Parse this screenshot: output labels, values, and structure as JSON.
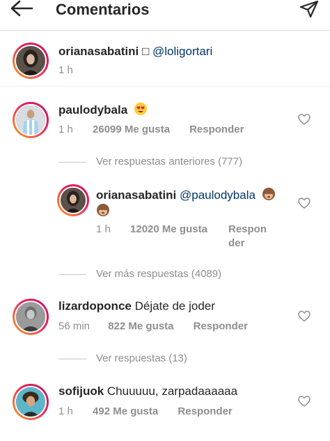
{
  "header": {
    "title": "Comentarios",
    "back_icon": "arrow-left-icon",
    "send_icon": "paper-plane-icon"
  },
  "caption": {
    "username": "orianasabatini",
    "glyph": "□",
    "mention": "@loligortari",
    "time": "1 h"
  },
  "comments": [
    {
      "username": "paulodybala",
      "text": "",
      "emoji": "smiling-face-with-heart-eyes",
      "time": "1 h",
      "likes": "26099 Me gusta",
      "reply": "Responder"
    },
    {
      "username": "orianasabatini",
      "mention": "@paulodybala",
      "emoji": "see-no-evil-monkey",
      "time": "1 h",
      "likes": "12020 Me gusta",
      "reply_line1": "Respon",
      "reply_line2": "der"
    },
    {
      "username": "lizardoponce",
      "text": "Déjate de joder",
      "time": "56 min",
      "likes": "822 Me gusta",
      "reply": "Responder"
    },
    {
      "username": "sofijuok",
      "text": "Chuuuuu, zarpadaaaaaa",
      "time": "1 h",
      "likes": "492 Me gusta",
      "reply": "Responder"
    }
  ],
  "replies_links": {
    "previous": "Ver respuestas anteriores (777)",
    "more": "Ver más respuestas (4089)",
    "view13": "Ver respuestas (13)"
  },
  "colors": {
    "text": "#262626",
    "secondary": "#8e8e8e",
    "mention": "#003569",
    "divider": "#dbdbdb"
  }
}
